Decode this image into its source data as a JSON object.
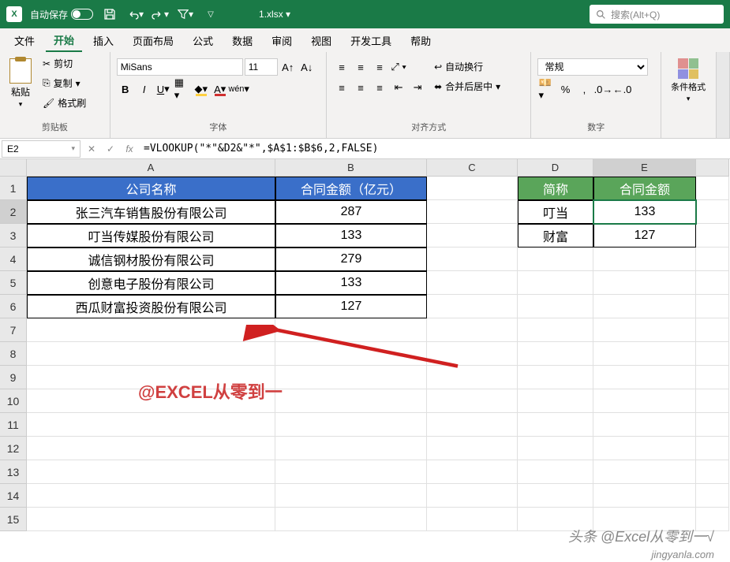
{
  "titlebar": {
    "autosave_label": "自动保存",
    "filename": "1.xlsx ▾",
    "search_placeholder": "搜索(Alt+Q)"
  },
  "menu": {
    "file": "文件",
    "home": "开始",
    "insert": "插入",
    "layout": "页面布局",
    "formula": "公式",
    "data": "数据",
    "review": "审阅",
    "view": "视图",
    "dev": "开发工具",
    "help": "帮助"
  },
  "ribbon": {
    "clipboard": {
      "paste": "粘贴",
      "cut": "剪切",
      "copy": "复制",
      "formatpainter": "格式刷",
      "label": "剪贴板"
    },
    "font": {
      "name": "MiSans",
      "size": "11",
      "label": "字体"
    },
    "align": {
      "wrap": "自动换行",
      "merge": "合并后居中",
      "label": "对齐方式"
    },
    "number": {
      "format": "常规",
      "label": "数字"
    },
    "styles": {
      "condfmt": "条件格式"
    }
  },
  "formulabar": {
    "namebox": "E2",
    "formula": "=VLOOKUP(\"*\"&D2&\"*\",$A$1:$B$6,2,FALSE)"
  },
  "columns": {
    "A": "A",
    "B": "B",
    "C": "C",
    "D": "D",
    "E": "E"
  },
  "headers": {
    "A": "公司名称",
    "B": "合同金额（亿元）",
    "D": "简称",
    "E": "合同金额"
  },
  "data": {
    "rows": [
      {
        "A": "张三汽车销售股份有限公司",
        "B": "287"
      },
      {
        "A": "叮当传媒股份有限公司",
        "B": "133"
      },
      {
        "A": "诚信钢材股份有限公司",
        "B": "279"
      },
      {
        "A": "创意电子股份有限公司",
        "B": "133"
      },
      {
        "A": "西瓜财富投资股份有限公司",
        "B": "127"
      }
    ],
    "lookup": [
      {
        "D": "叮当",
        "E": "133"
      },
      {
        "D": "财富",
        "E": "127"
      }
    ]
  },
  "watermarks": {
    "red": "@EXCEL从零到一",
    "gray": "头条 @Excel从零到一√",
    "gray2": "jingyanla.com"
  },
  "chart_data": {
    "type": "table",
    "title": "",
    "tables": [
      {
        "columns": [
          "公司名称",
          "合同金额（亿元）"
        ],
        "rows": [
          [
            "张三汽车销售股份有限公司",
            287
          ],
          [
            "叮当传媒股份有限公司",
            133
          ],
          [
            "诚信钢材股份有限公司",
            279
          ],
          [
            "创意电子股份有限公司",
            133
          ],
          [
            "西瓜财富投资股份有限公司",
            127
          ]
        ]
      },
      {
        "columns": [
          "简称",
          "合同金额"
        ],
        "rows": [
          [
            "叮当",
            133
          ],
          [
            "财富",
            127
          ]
        ]
      }
    ]
  }
}
